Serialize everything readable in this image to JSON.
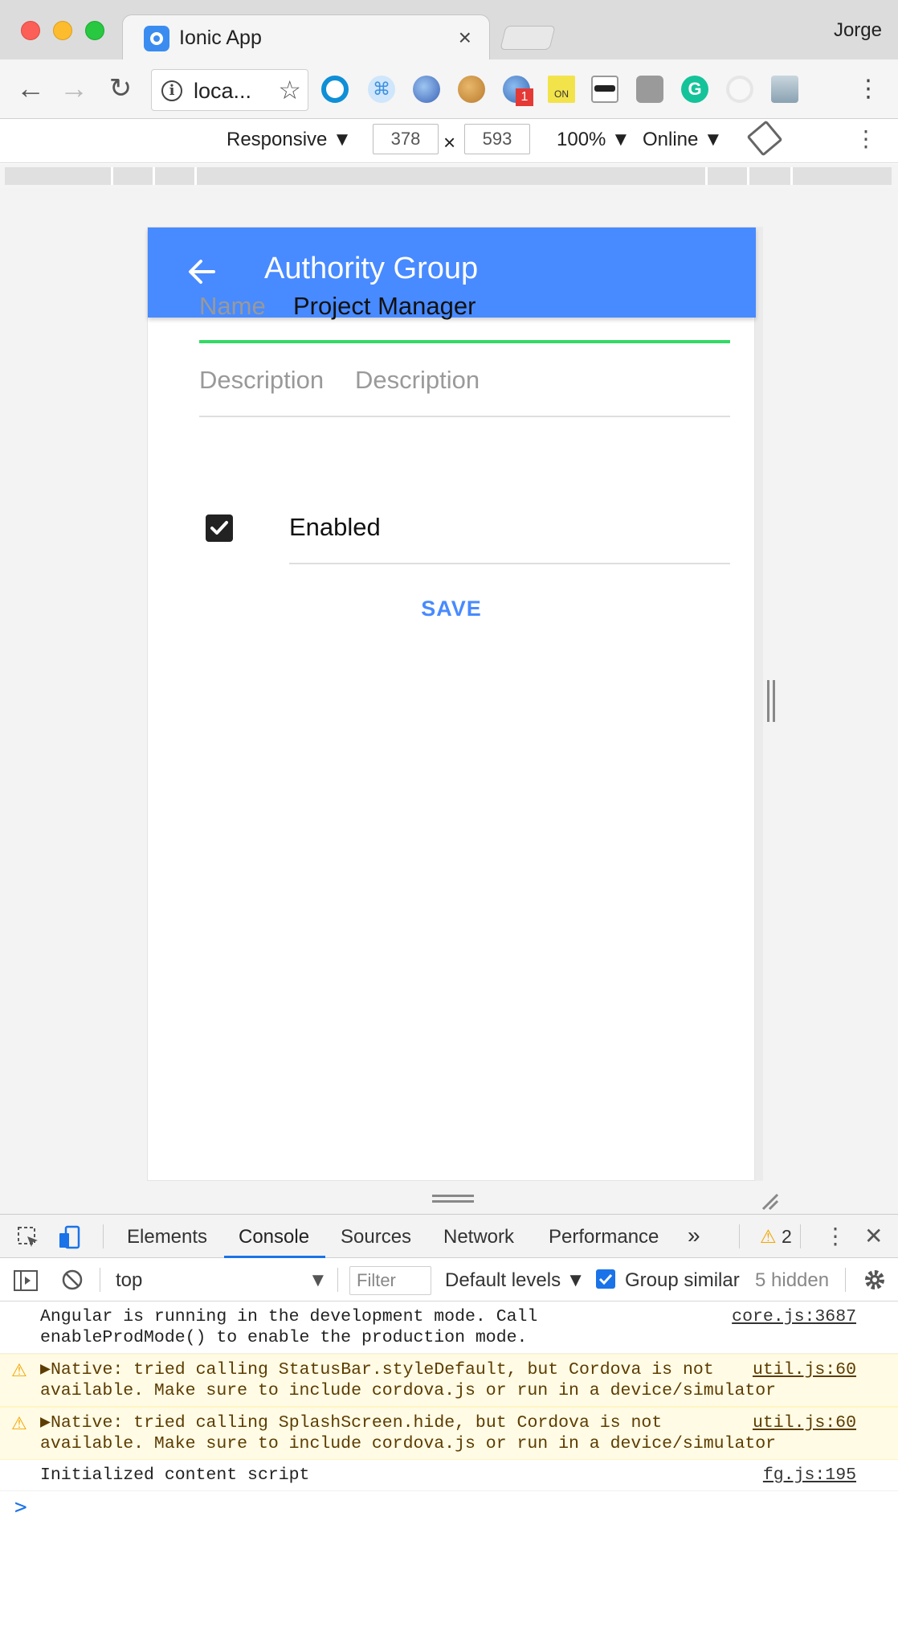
{
  "window": {
    "tab_title": "Ionic App",
    "tab_close": "×",
    "profile_name": "Jorge"
  },
  "toolbar": {
    "url_text": "loca...",
    "extension_badge": "1",
    "extension_on_label": "ON"
  },
  "device_toolbar": {
    "device_mode": "Responsive ▼",
    "width": "378",
    "times": "×",
    "height": "593",
    "zoom": "100% ▼",
    "network": "Online ▼"
  },
  "app": {
    "header_title": "Authority Group",
    "accent_color": "#488aff",
    "focus_color": "#32db64",
    "fields": {
      "name_label": "Name",
      "name_value": "Project Manager",
      "description_label": "Description",
      "description_placeholder": "Description"
    },
    "enabled_label": "Enabled",
    "enabled_checked": true,
    "save_label": "SAVE"
  },
  "devtools": {
    "tabs": [
      "Elements",
      "Console",
      "Sources",
      "Network",
      "Performance"
    ],
    "more_tabs": "»",
    "active_tab": "Console",
    "warning_count": "2",
    "context": "top",
    "filter_placeholder": "Filter",
    "levels": "Default levels ▼",
    "group_similar_label": "Group similar",
    "hidden_count": "5 hidden",
    "messages": [
      {
        "level": "info",
        "text": "Angular is running in the development mode. Call\nenableProdMode() to enable the production mode.",
        "source": "core.js:3687"
      },
      {
        "level": "warning",
        "text": "▶Native: tried calling StatusBar.styleDefault, but Cordova is not\navailable. Make sure to include cordova.js or run in a device/simulator",
        "source": "util.js:60"
      },
      {
        "level": "warning",
        "text": "▶Native: tried calling SplashScreen.hide, but Cordova is not\navailable. Make sure to include cordova.js or run in a device/simulator",
        "source": "util.js:60"
      },
      {
        "level": "info",
        "text": "Initialized content script",
        "source": "fg.js:195"
      }
    ],
    "prompt_symbol": ">"
  }
}
